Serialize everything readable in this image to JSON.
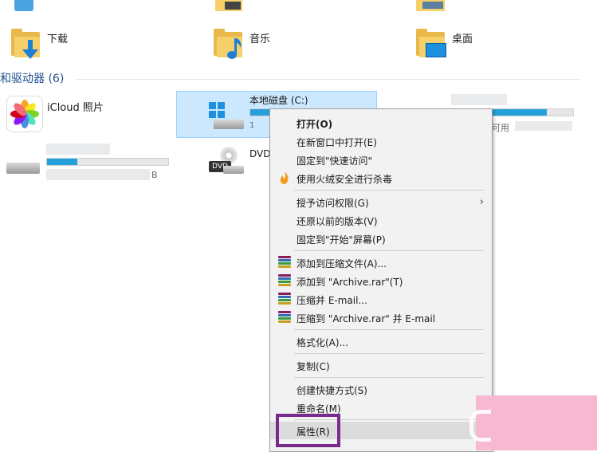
{
  "folders": [
    {
      "label": "下载",
      "icon": "download-folder-icon"
    },
    {
      "label": "音乐",
      "icon": "music-folder-icon"
    },
    {
      "label": "桌面",
      "icon": "desktop-folder-icon"
    }
  ],
  "section": {
    "title": "和驱动器 (6)"
  },
  "devices": {
    "icloud": {
      "label": "iCloud 照片",
      "icon": "icloud-photos-icon"
    },
    "local_disk": {
      "label": "本地磁盘 (C:)",
      "partial": "1",
      "fill_percent": 30
    },
    "dvd": {
      "label": "DVD"
    },
    "right_drive_partial": "可用",
    "left_drive_partial": "B"
  },
  "context_menu": {
    "items": [
      {
        "label": "打开(O)",
        "bold": true
      },
      {
        "label": "在新窗口中打开(E)"
      },
      {
        "label": "固定到\"快速访问\""
      },
      {
        "label": "使用火绒安全进行杀毒",
        "icon": "huorong-icon"
      },
      {
        "label": "授予访问权限(G)",
        "submenu": true
      },
      {
        "label": "还原以前的版本(V)"
      },
      {
        "label": "固定到\"开始\"屏幕(P)"
      },
      {
        "label": "添加到压缩文件(A)...",
        "icon": "winrar-icon"
      },
      {
        "label": "添加到 \"Archive.rar\"(T)",
        "icon": "winrar-icon"
      },
      {
        "label": "压缩并 E-mail...",
        "icon": "winrar-icon"
      },
      {
        "label": "压缩到 \"Archive.rar\" 并 E-mail",
        "icon": "winrar-icon"
      },
      {
        "label": "格式化(A)..."
      },
      {
        "label": "复制(C)"
      },
      {
        "label": "创建快捷方式(S)"
      },
      {
        "label": "重命名(M)"
      },
      {
        "label": "属性(R)"
      }
    ],
    "submenu_glyph": "›"
  },
  "colors": {
    "accent": "#26a0da",
    "highlight_box": "#7a2a8c",
    "selection": "#cce8ff"
  }
}
